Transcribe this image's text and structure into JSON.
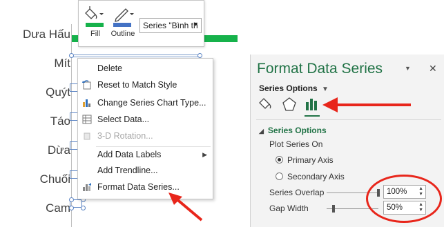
{
  "chart": {
    "categories": [
      "Dưa Hấu",
      "Mít",
      "Quýt",
      "Táo",
      "Dừa",
      "Chuối",
      "Cam"
    ],
    "bar_color": "#16b24b"
  },
  "mini_toolbar": {
    "fill_label": "Fill",
    "outline_label": "Outline",
    "series_select_value": "Series \"Bình th"
  },
  "context_menu": {
    "items": [
      {
        "label": "Delete",
        "icon": "delete-icon",
        "enabled": true
      },
      {
        "label": "Reset to Match Style",
        "icon": "reset-style-icon",
        "enabled": true
      },
      {
        "label": "Change Series Chart Type...",
        "icon": "chart-type-icon",
        "enabled": true
      },
      {
        "label": "Select Data...",
        "icon": "select-data-icon",
        "enabled": true
      },
      {
        "label": "3-D Rotation...",
        "icon": "3d-rotation-icon",
        "enabled": false
      },
      {
        "label": "Add Data Labels",
        "icon": "",
        "enabled": true,
        "submenu": true
      },
      {
        "label": "Add Trendline...",
        "icon": "",
        "enabled": true
      },
      {
        "label": "Format Data Series...",
        "icon": "format-series-icon",
        "enabled": true
      }
    ]
  },
  "format_pane": {
    "title": "Format Data Series",
    "options_dropdown": "Series Options",
    "section_title": "Series Options",
    "plot_series_on": "Plot Series On",
    "primary_axis": "Primary Axis",
    "secondary_axis": "Secondary Axis",
    "primary_selected": true,
    "series_overlap_label": "Series Overlap",
    "series_overlap_value": "100%",
    "gap_width_label": "Gap Width",
    "gap_width_value": "50%",
    "accent_color": "#217346"
  },
  "annotation_color": "#e8261b"
}
